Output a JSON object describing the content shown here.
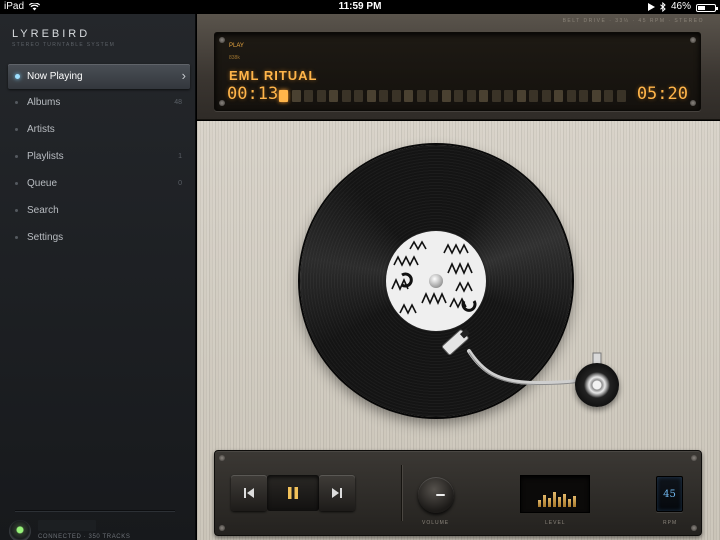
{
  "status_bar": {
    "device": "iPad",
    "time": "11:59 PM",
    "battery": "46%",
    "battery_level": 0.46,
    "icons": [
      "wifi-icon",
      "play-icon",
      "bluetooth-icon",
      "battery-icon"
    ]
  },
  "sidebar": {
    "app_title": "LYREBIRD",
    "app_subtitle": "STEREO TURNTABLE SYSTEM",
    "items": [
      {
        "label": "Now Playing",
        "count": "",
        "active": true
      },
      {
        "label": "Albums",
        "count": "48"
      },
      {
        "label": "Artists",
        "count": ""
      },
      {
        "label": "Playlists",
        "count": "1"
      },
      {
        "label": "Queue",
        "count": "0"
      },
      {
        "label": "Search",
        "count": ""
      },
      {
        "label": "Settings",
        "count": ""
      }
    ],
    "connection": "CONNECTED · 350 TRACKS"
  },
  "header": {
    "specs": "BELT DRIVE · 33⅓ · 45 RPM · STEREO"
  },
  "display": {
    "state": "PLAY",
    "bitrate": "838k",
    "track_title": "EML RITUAL",
    "elapsed": "00:13",
    "total": "05:20",
    "progress": 0.04
  },
  "controls": {
    "volume_label": "VOLUME",
    "level_label": "LEVEL",
    "rpm_label": "RPM",
    "rpm_value": "45",
    "level_meter": [
      0.35,
      0.6,
      0.45,
      0.75,
      0.5,
      0.65,
      0.4,
      0.55
    ],
    "volume_level": 0.2
  },
  "colors": {
    "lcd_amber": "#ffb54a",
    "active_led": "#9fe0ff",
    "connected_led": "#97f37a",
    "rpm_blue": "#6fb6ee"
  }
}
